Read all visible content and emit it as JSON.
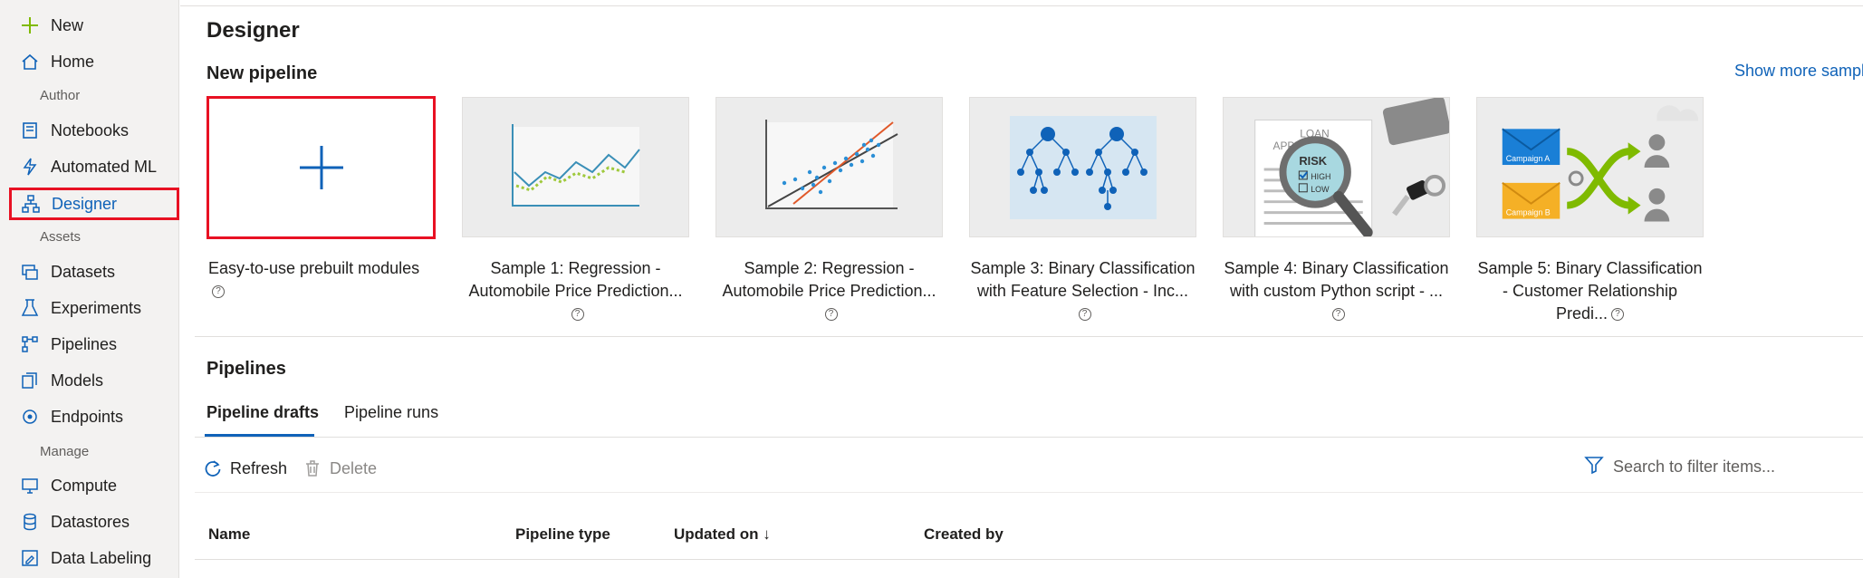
{
  "sidebar": {
    "top_items": [
      {
        "label": "New",
        "icon": "plus-icon"
      },
      {
        "label": "Home",
        "icon": "home-icon"
      }
    ],
    "sections": [
      {
        "title": "Author"
      },
      {
        "title": "Assets"
      },
      {
        "title": "Manage"
      }
    ],
    "author_items": [
      {
        "label": "Notebooks",
        "icon": "notebook-icon"
      },
      {
        "label": "Automated ML",
        "icon": "lightning-icon"
      },
      {
        "label": "Designer",
        "icon": "designer-icon",
        "active": true
      }
    ],
    "assets_items": [
      {
        "label": "Datasets",
        "icon": "dataset-icon"
      },
      {
        "label": "Experiments",
        "icon": "flask-icon"
      },
      {
        "label": "Pipelines",
        "icon": "pipeline-icon"
      },
      {
        "label": "Models",
        "icon": "models-icon"
      },
      {
        "label": "Endpoints",
        "icon": "endpoint-icon"
      }
    ],
    "manage_items": [
      {
        "label": "Compute",
        "icon": "monitor-icon"
      },
      {
        "label": "Datastores",
        "icon": "database-icon"
      },
      {
        "label": "Data Labeling",
        "icon": "labeling-icon"
      }
    ]
  },
  "main": {
    "title": "Designer",
    "new_pipeline_title": "New pipeline",
    "show_more": "Show more sampl",
    "cards": [
      {
        "caption": "Easy-to-use prebuilt modules",
        "type": "new"
      },
      {
        "caption": "Sample 1: Regression - Automobile Price Prediction...",
        "type": "line-chart"
      },
      {
        "caption": "Sample 2: Regression - Automobile Price Prediction...",
        "type": "scatter"
      },
      {
        "caption": "Sample 3: Binary Classification with Feature Selection - Inc...",
        "type": "trees"
      },
      {
        "caption": "Sample 4: Binary Classification with custom Python script - ...",
        "type": "loan"
      },
      {
        "caption": "Sample 5: Binary Classification - Customer Relationship Predi...",
        "type": "campaign"
      }
    ],
    "card4_text": {
      "loan": "LOAN",
      "applic": "APPLIC",
      "risk": "RISK",
      "high": "HIGH",
      "low": "LOW"
    },
    "card5_text": {
      "a": "Campaign A",
      "b": "Campaign B"
    },
    "pipelines_title": "Pipelines",
    "tabs": [
      "Pipeline drafts",
      "Pipeline runs"
    ],
    "commands": {
      "refresh": "Refresh",
      "delete": "Delete"
    },
    "search_placeholder": "Search to filter items...",
    "columns": [
      "Name",
      "Pipeline type",
      "Updated on ↓",
      "Created by"
    ]
  },
  "colors": {
    "accent": "#0f62b8",
    "highlight": "#e81123",
    "green": "#7fba00"
  }
}
